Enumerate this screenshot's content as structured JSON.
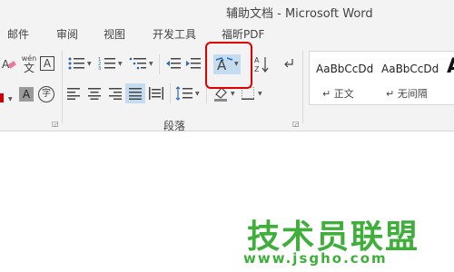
{
  "window": {
    "title": "辅助文档 - Microsoft Word"
  },
  "menu": {
    "items": [
      "邮件",
      "审阅",
      "视图",
      "开发工具",
      "福昕PDF"
    ]
  },
  "ribbon": {
    "font_group": {
      "phonetic_label": "wén",
      "phonetic_char": "文",
      "border_char": "A",
      "shade_char": "A",
      "enclose_char": "字"
    },
    "paragraph_group": {
      "label": "段落"
    },
    "styles": [
      {
        "sample": "AaBbCcDd",
        "name": "↵ 正文"
      },
      {
        "sample": "AaBbCcDd",
        "name": "↵ 无间隔"
      },
      {
        "sample": "A",
        "name": ""
      }
    ],
    "sort_label": "A↓Z"
  },
  "watermark": {
    "text": "技术员联盟",
    "url": "www.jsgho.com"
  },
  "colors": {
    "highlight": "#e00000",
    "watermark": "#3fae3a",
    "active": "#c5dbf0"
  }
}
